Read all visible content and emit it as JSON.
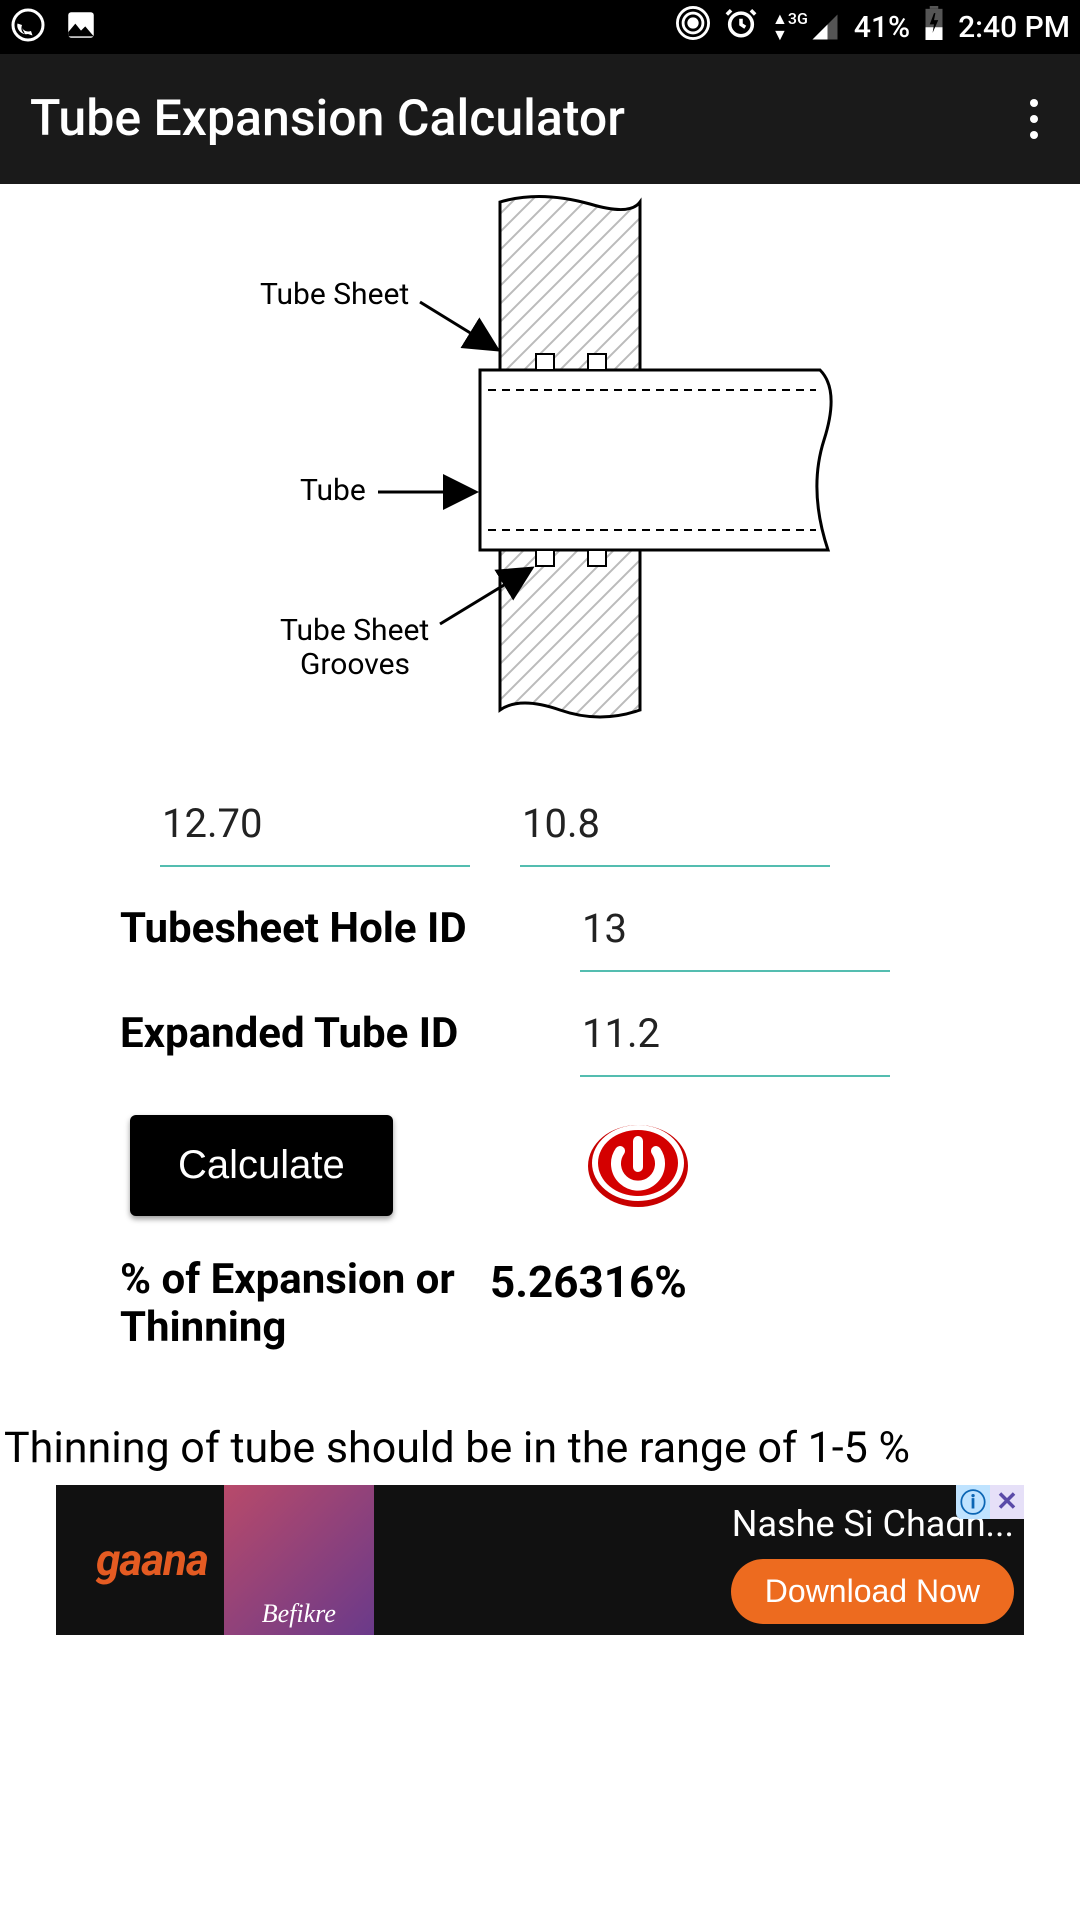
{
  "status": {
    "battery": "41%",
    "time": "2:40 PM",
    "network": "3G"
  },
  "appbar": {
    "title": "Tube Expansion Calculator"
  },
  "diagram": {
    "label_sheet": "Tube Sheet",
    "label_tube": "Tube",
    "label_grooves": "Tube Sheet\nGrooves"
  },
  "inputs": {
    "val1": "12.70",
    "val2": "10.8",
    "hole_id_label": "Tubesheet Hole ID",
    "hole_id": "13",
    "expanded_id_label": "Expanded Tube ID",
    "expanded_id": "11.2"
  },
  "actions": {
    "calculate": "Calculate"
  },
  "result": {
    "label": "% of Expansion or Thinning",
    "value": "5.26316%"
  },
  "note": "Thinning of tube should be in the range of 1-5 %",
  "ad": {
    "brand": "gaana",
    "text": "Nashe Si Chadh...",
    "cta": "Download Now",
    "thumb_caption": "Befikre"
  }
}
